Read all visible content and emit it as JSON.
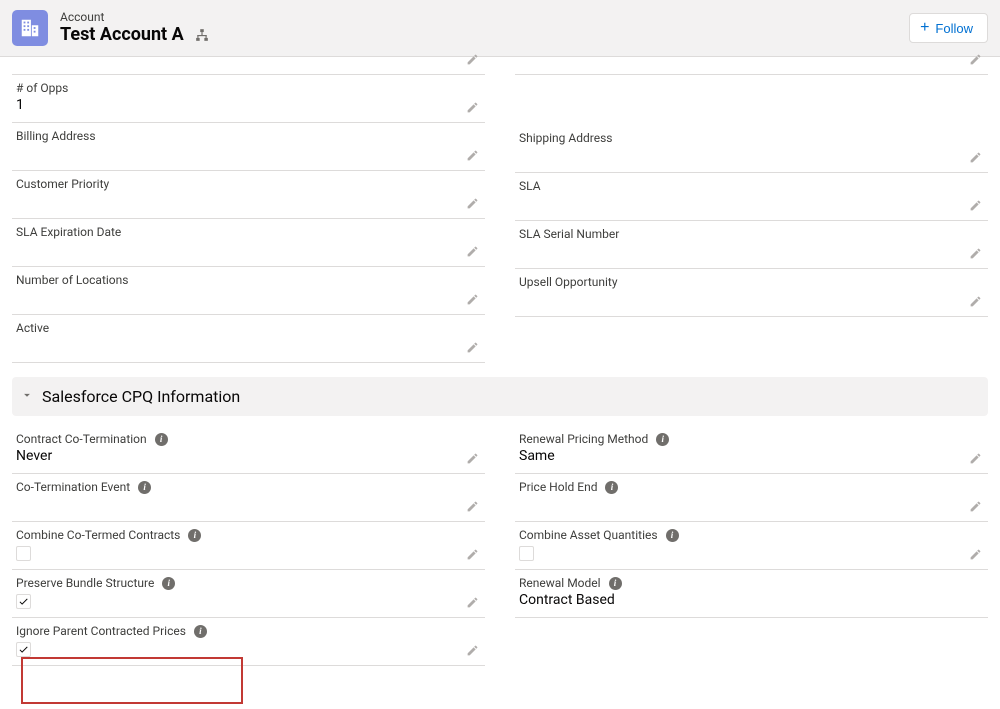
{
  "header": {
    "object_label": "Account",
    "title": "Test Account A",
    "follow_label": "Follow"
  },
  "fields_left_1": [
    {
      "label": "# of Opps",
      "value": "1",
      "editable": true,
      "has_info": false,
      "type": "text"
    },
    {
      "label": "Billing Address",
      "value": "",
      "editable": true,
      "has_info": false,
      "type": "text"
    },
    {
      "label": "Customer Priority",
      "value": "",
      "editable": true,
      "has_info": false,
      "type": "text"
    },
    {
      "label": "SLA Expiration Date",
      "value": "",
      "editable": true,
      "has_info": false,
      "type": "text"
    },
    {
      "label": "Number of Locations",
      "value": "",
      "editable": true,
      "has_info": false,
      "type": "text"
    },
    {
      "label": "Active",
      "value": "",
      "editable": true,
      "has_info": false,
      "type": "text"
    }
  ],
  "fields_right_1": [
    {
      "label": "Shipping Address",
      "value": "",
      "editable": true,
      "has_info": false,
      "type": "text"
    },
    {
      "label": "SLA",
      "value": "",
      "editable": true,
      "has_info": false,
      "type": "text"
    },
    {
      "label": "SLA Serial Number",
      "value": "",
      "editable": true,
      "has_info": false,
      "type": "text"
    },
    {
      "label": "Upsell Opportunity",
      "value": "",
      "editable": true,
      "has_info": false,
      "type": "text"
    }
  ],
  "section_title": "Salesforce CPQ Information",
  "fields_left_2": [
    {
      "label": "Contract Co-Termination",
      "value": "Never",
      "editable": true,
      "has_info": true,
      "type": "text"
    },
    {
      "label": "Co-Termination Event",
      "value": "",
      "editable": true,
      "has_info": true,
      "type": "text"
    },
    {
      "label": "Combine Co-Termed Contracts",
      "value": "",
      "editable": true,
      "has_info": true,
      "type": "checkbox",
      "checked": false
    },
    {
      "label": "Preserve Bundle Structure",
      "value": "",
      "editable": true,
      "has_info": true,
      "type": "checkbox",
      "checked": true
    },
    {
      "label": "Ignore Parent Contracted Prices",
      "value": "",
      "editable": true,
      "has_info": true,
      "type": "checkbox",
      "checked": true
    }
  ],
  "fields_right_2": [
    {
      "label": "Renewal Pricing Method",
      "value": "Same",
      "editable": true,
      "has_info": true,
      "type": "text"
    },
    {
      "label": "Price Hold End",
      "value": "",
      "editable": true,
      "has_info": true,
      "type": "text"
    },
    {
      "label": "Combine Asset Quantities",
      "value": "",
      "editable": true,
      "has_info": true,
      "type": "checkbox",
      "checked": false
    },
    {
      "label": "Renewal Model",
      "value": "Contract Based",
      "editable": false,
      "has_info": true,
      "type": "text"
    }
  ]
}
